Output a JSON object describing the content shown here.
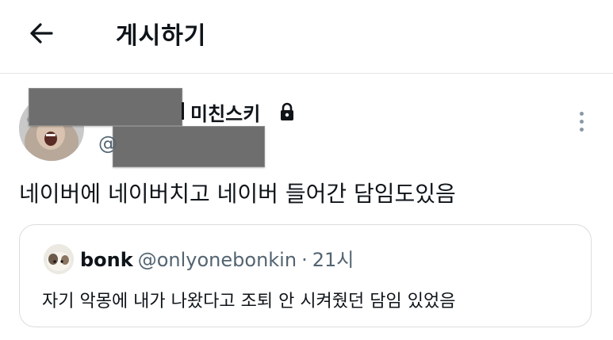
{
  "header": {
    "title": "게시하기",
    "back_icon": "arrow-left-icon"
  },
  "post": {
    "display_name": "미친스키",
    "handle_prefix": "@",
    "lock_icon": "lock-icon",
    "more_icon": "more-vertical-icon",
    "text": "네이버에 네이버치고 네이버 들어간 담임도있음"
  },
  "quote": {
    "name": "bonk",
    "handle": "@onlyonebonkin",
    "separator": "·",
    "time": "21시",
    "text": "자기 악몽에 내가 나왔다고 조퇴 안 시켜줬던 담임 있었음"
  },
  "colors": {
    "primary_text": "#0f1419",
    "secondary_text": "#536471",
    "border": "#dcdcdc",
    "redaction": "#6e6e6e"
  }
}
